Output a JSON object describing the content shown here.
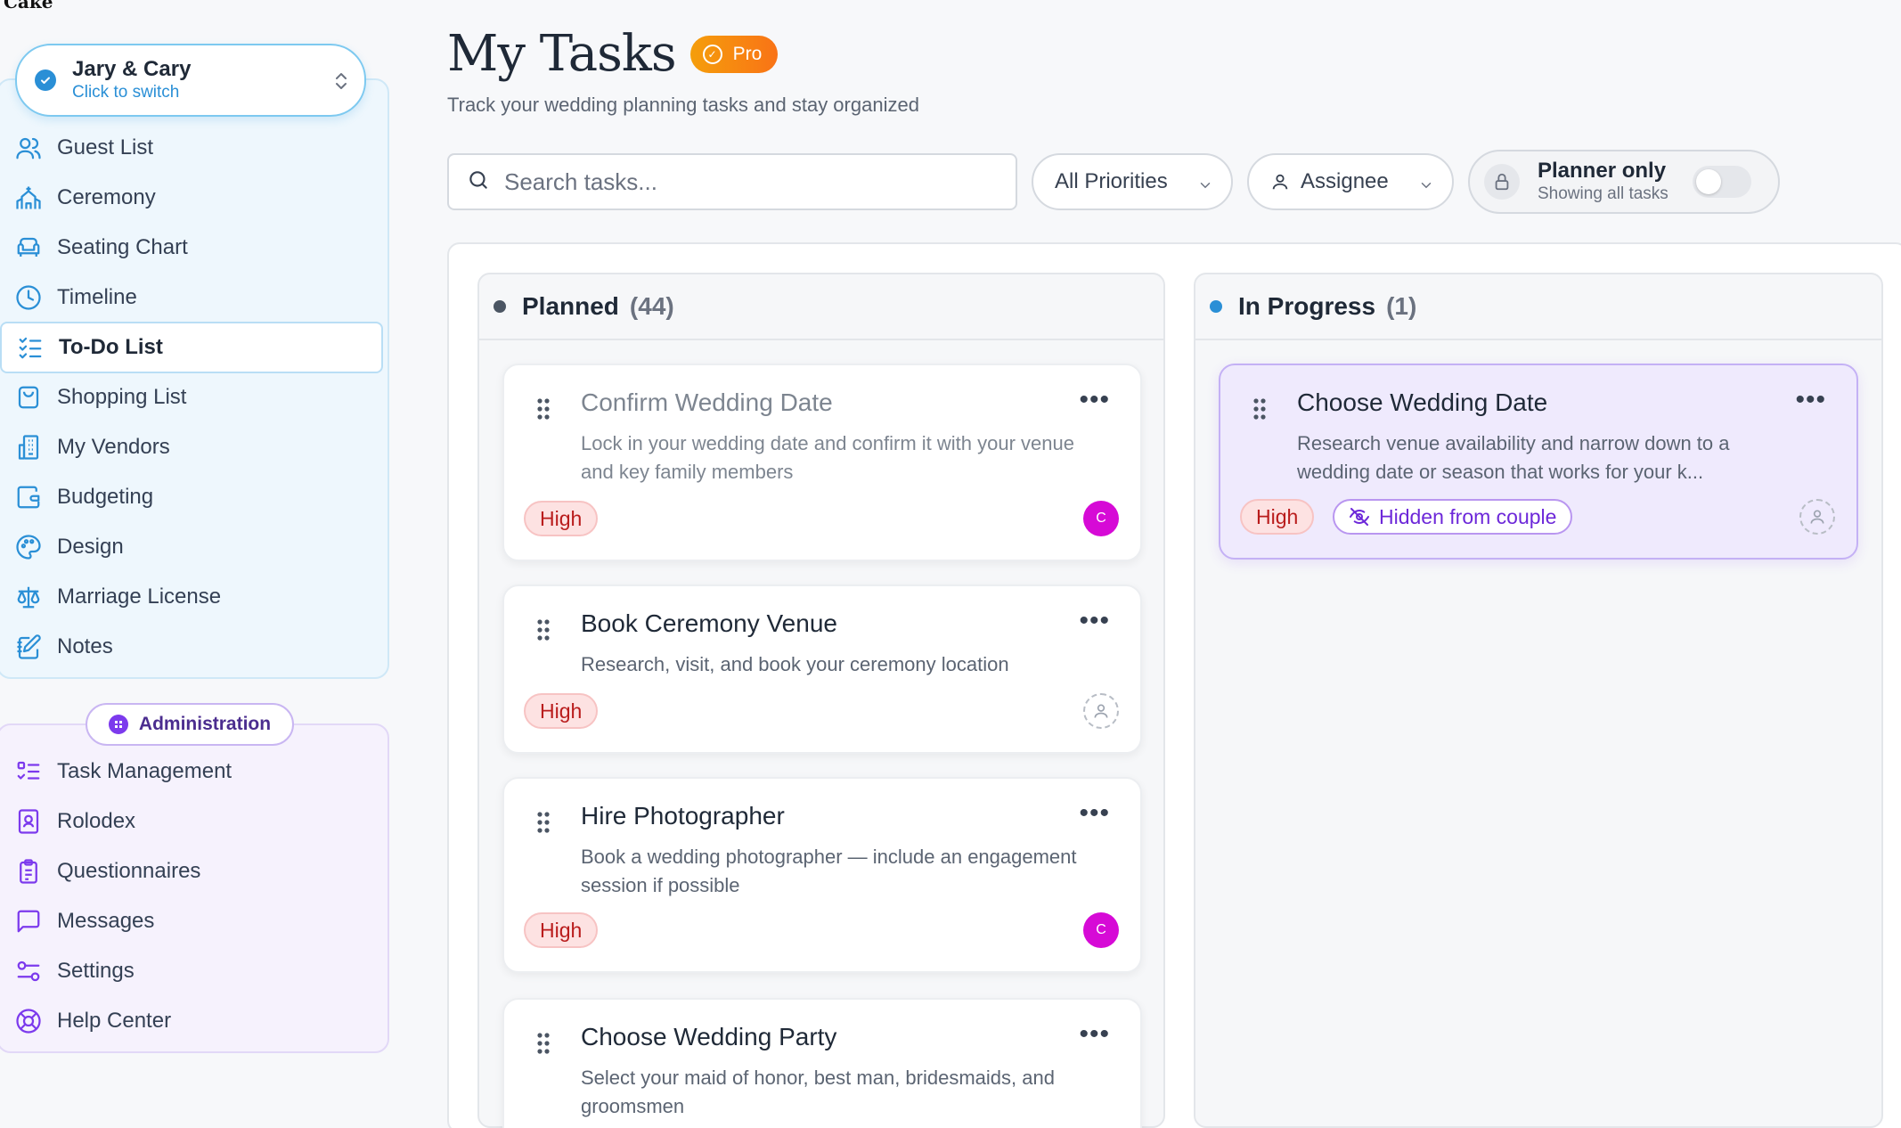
{
  "brand": "Cake",
  "switcher": {
    "name": "Jary & Cary",
    "sub": "Click to switch"
  },
  "nav": {
    "items": [
      {
        "label": "Guest List"
      },
      {
        "label": "Ceremony"
      },
      {
        "label": "Seating Chart"
      },
      {
        "label": "Timeline"
      },
      {
        "label": "To-Do List"
      },
      {
        "label": "Shopping List"
      },
      {
        "label": "My Vendors"
      },
      {
        "label": "Budgeting"
      },
      {
        "label": "Design"
      },
      {
        "label": "Marriage License"
      },
      {
        "label": "Notes"
      }
    ],
    "active": "To-Do List"
  },
  "admin": {
    "label": "Administration",
    "items": [
      {
        "label": "Task Management"
      },
      {
        "label": "Rolodex"
      },
      {
        "label": "Questionnaires"
      },
      {
        "label": "Messages"
      },
      {
        "label": "Settings"
      },
      {
        "label": "Help Center"
      }
    ]
  },
  "header": {
    "title": "My Tasks",
    "badge": "Pro",
    "subtitle": "Track your wedding planning tasks and stay organized"
  },
  "filters": {
    "search_placeholder": "Search tasks...",
    "priority": "All Priorities",
    "assignee": "Assignee",
    "planner_title": "Planner only",
    "planner_sub": "Showing all tasks",
    "planner_toggle_on": false
  },
  "columns": {
    "planned": {
      "label": "Planned",
      "count": "(44)",
      "cards": [
        {
          "title": "Confirm Wedding Date",
          "desc": "Lock in your wedding date and confirm it with your venue and key family members",
          "priority": "High",
          "assignee": "C"
        },
        {
          "title": "Book Ceremony Venue",
          "desc": "Research, visit, and book your ceremony location",
          "priority": "High",
          "assignee": ""
        },
        {
          "title": "Hire Photographer",
          "desc": "Book a wedding photographer — include an engagement session if possible",
          "priority": "High",
          "assignee": "C"
        },
        {
          "title": "Choose Wedding Party",
          "desc": "Select your maid of honor, best man, bridesmaids, and groomsmen",
          "priority": "",
          "assignee": ""
        }
      ]
    },
    "in_progress": {
      "label": "In Progress",
      "count": "(1)",
      "cards": [
        {
          "title": "Choose Wedding Date",
          "desc": "Research venue availability and narrow down to a wedding date or season that works for your k...",
          "priority": "High",
          "tag": "Hidden from couple",
          "assignee": ""
        }
      ]
    }
  },
  "colors": {
    "accent_blue": "#2a8fd6",
    "accent_purple": "#7c3aed",
    "pro_orange": "#f59e0b",
    "high_red": "#b91c1c",
    "avatar_magenta": "#d60ad6"
  }
}
